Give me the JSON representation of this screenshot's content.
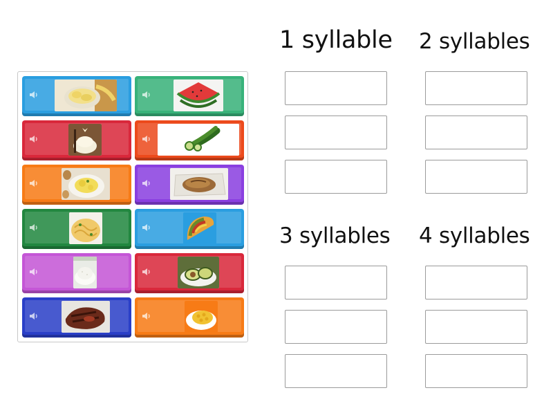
{
  "categories": [
    {
      "label": "1 syllable"
    },
    {
      "label": "2 syllables"
    },
    {
      "label": "3 syllables"
    },
    {
      "label": "4 syllables"
    }
  ],
  "tiles": [
    {
      "name": "banana",
      "color": "#2a9ee0",
      "icon": "speaker-icon"
    },
    {
      "name": "watermelon",
      "color": "#38b27a",
      "icon": "speaker-icon"
    },
    {
      "name": "vanilla",
      "color": "#d9283b",
      "icon": "speaker-icon"
    },
    {
      "name": "cucumber",
      "color": "#ec4a1c",
      "icon": "speaker-icon"
    },
    {
      "name": "eggs",
      "color": "#f77b16",
      "icon": "speaker-icon"
    },
    {
      "name": "chicken",
      "color": "#8a3fe0",
      "icon": "speaker-icon"
    },
    {
      "name": "spaghetti",
      "color": "#21873f",
      "icon": "speaker-icon"
    },
    {
      "name": "taco",
      "color": "#2a9ee0",
      "icon": "speaker-icon"
    },
    {
      "name": "rice",
      "color": "#c456d6",
      "icon": "speaker-icon"
    },
    {
      "name": "avocado",
      "color": "#d9283b",
      "icon": "speaker-icon"
    },
    {
      "name": "steak",
      "color": "#2a3fc8",
      "icon": "speaker-icon"
    },
    {
      "name": "macaroni",
      "color": "#f77b16",
      "icon": "speaker-icon"
    }
  ]
}
